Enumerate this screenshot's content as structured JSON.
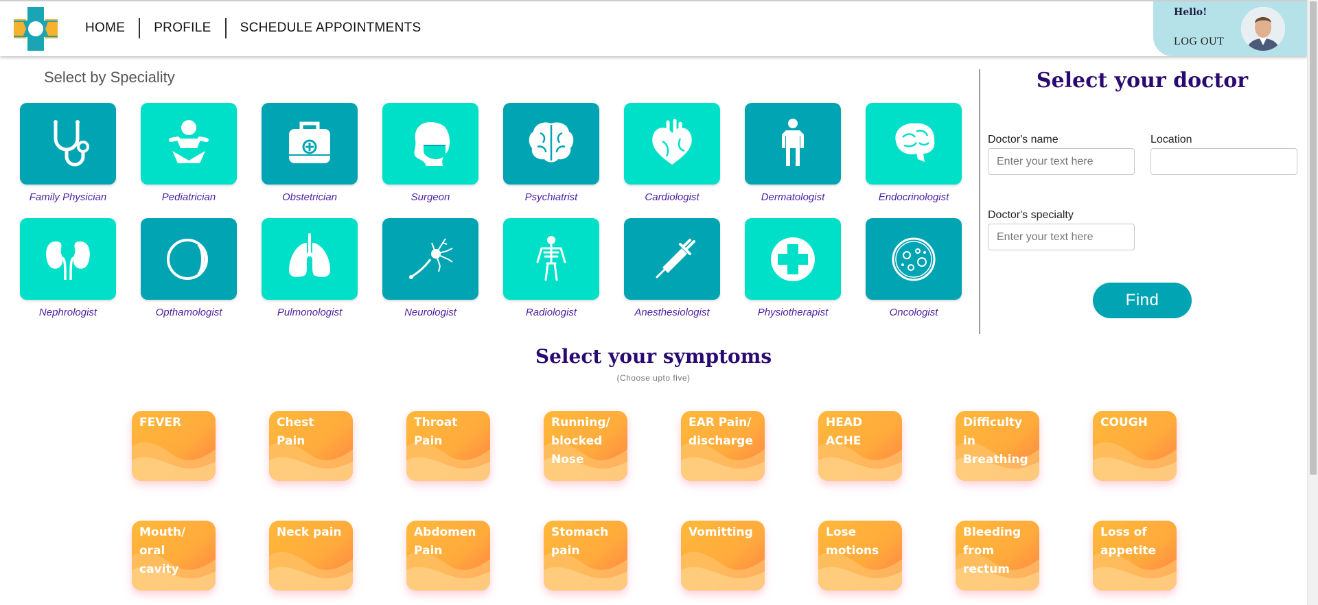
{
  "nav": {
    "items": [
      {
        "label": "HOME"
      },
      {
        "label": "PROFILE"
      },
      {
        "label": "SCHEDULE APPOINTMENTS"
      }
    ]
  },
  "user": {
    "greeting": "Hello!",
    "logout_label": "LOG OUT"
  },
  "speciality": {
    "title": "Select by Speciality",
    "items": [
      {
        "label": "Family Physician",
        "icon": "stethoscope-icon",
        "tone": "dark"
      },
      {
        "label": "Pediatrician",
        "icon": "baby-icon",
        "tone": "light"
      },
      {
        "label": "Obstetrician",
        "icon": "medical-bag-icon",
        "tone": "dark"
      },
      {
        "label": "Surgeon",
        "icon": "surgeon-mask-icon",
        "tone": "light"
      },
      {
        "label": "Psychiatrist",
        "icon": "brain-icon",
        "tone": "dark"
      },
      {
        "label": "Cardiologist",
        "icon": "heart-icon",
        "tone": "light"
      },
      {
        "label": "Dermatologist",
        "icon": "human-body-icon",
        "tone": "dark"
      },
      {
        "label": "Endocrinologist",
        "icon": "brain-side-icon",
        "tone": "light"
      },
      {
        "label": "Nephrologist",
        "icon": "kidneys-icon",
        "tone": "light"
      },
      {
        "label": "Opthamologist",
        "icon": "eye-icon",
        "tone": "dark"
      },
      {
        "label": "Pulmonologist",
        "icon": "lungs-icon",
        "tone": "light"
      },
      {
        "label": "Neurologist",
        "icon": "neuron-icon",
        "tone": "dark"
      },
      {
        "label": "Radiologist",
        "icon": "skeleton-icon",
        "tone": "light"
      },
      {
        "label": "Anesthesiologist",
        "icon": "syringe-icon",
        "tone": "dark"
      },
      {
        "label": "Physiotherapist",
        "icon": "medical-cross-icon",
        "tone": "light"
      },
      {
        "label": "Oncologist",
        "icon": "cell-icon",
        "tone": "dark"
      }
    ]
  },
  "doctor": {
    "title": "Select your doctor",
    "name_label": "Doctor's name",
    "name_placeholder": "Enter your text here",
    "location_label": "Location",
    "location_placeholder": "",
    "specialty_label": "Doctor's specialty",
    "specialty_placeholder": "Enter your text here",
    "find_label": "Find"
  },
  "symptoms": {
    "title": "Select your symptoms",
    "subtitle": "(Choose upto five)",
    "items": [
      {
        "label": "FEVER"
      },
      {
        "label": "Chest Pain"
      },
      {
        "label": "Throat\nPain"
      },
      {
        "label": "Running/\nblocked\nNose"
      },
      {
        "label": "EAR Pain/\ndischarge"
      },
      {
        "label": "HEAD\nACHE"
      },
      {
        "label": "Difficulty\nin\nBreathing"
      },
      {
        "label": "COUGH"
      },
      {
        "label": "Mouth/\noral cavity"
      },
      {
        "label": "Neck pain"
      },
      {
        "label": "Abdomen\nPain"
      },
      {
        "label": "Stomach\npain"
      },
      {
        "label": "Vomitting"
      },
      {
        "label": "Lose\nmotions"
      },
      {
        "label": "Bleeding\nfrom\nrectum"
      },
      {
        "label": "Loss of\nappetite"
      }
    ]
  },
  "colors": {
    "tile_dark": "#00a4b2",
    "tile_light": "#00e0c8",
    "accent": "#00a4b2",
    "title_purple": "#2a0a70",
    "symptom_orange": "#ffb03c"
  }
}
